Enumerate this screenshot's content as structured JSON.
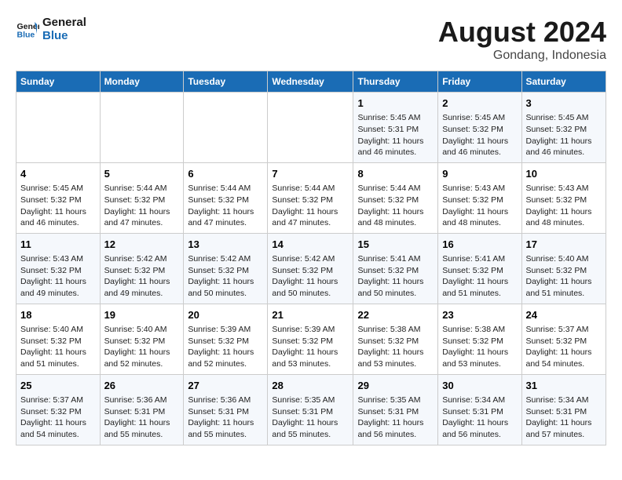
{
  "logo": {
    "line1": "General",
    "line2": "Blue"
  },
  "title": "August 2024",
  "subtitle": "Gondang, Indonesia",
  "days_header": [
    "Sunday",
    "Monday",
    "Tuesday",
    "Wednesday",
    "Thursday",
    "Friday",
    "Saturday"
  ],
  "weeks": [
    [
      {
        "num": "",
        "info": ""
      },
      {
        "num": "",
        "info": ""
      },
      {
        "num": "",
        "info": ""
      },
      {
        "num": "",
        "info": ""
      },
      {
        "num": "1",
        "info": "Sunrise: 5:45 AM\nSunset: 5:31 PM\nDaylight: 11 hours and 46 minutes."
      },
      {
        "num": "2",
        "info": "Sunrise: 5:45 AM\nSunset: 5:32 PM\nDaylight: 11 hours and 46 minutes."
      },
      {
        "num": "3",
        "info": "Sunrise: 5:45 AM\nSunset: 5:32 PM\nDaylight: 11 hours and 46 minutes."
      }
    ],
    [
      {
        "num": "4",
        "info": "Sunrise: 5:45 AM\nSunset: 5:32 PM\nDaylight: 11 hours and 46 minutes."
      },
      {
        "num": "5",
        "info": "Sunrise: 5:44 AM\nSunset: 5:32 PM\nDaylight: 11 hours and 47 minutes."
      },
      {
        "num": "6",
        "info": "Sunrise: 5:44 AM\nSunset: 5:32 PM\nDaylight: 11 hours and 47 minutes."
      },
      {
        "num": "7",
        "info": "Sunrise: 5:44 AM\nSunset: 5:32 PM\nDaylight: 11 hours and 47 minutes."
      },
      {
        "num": "8",
        "info": "Sunrise: 5:44 AM\nSunset: 5:32 PM\nDaylight: 11 hours and 48 minutes."
      },
      {
        "num": "9",
        "info": "Sunrise: 5:43 AM\nSunset: 5:32 PM\nDaylight: 11 hours and 48 minutes."
      },
      {
        "num": "10",
        "info": "Sunrise: 5:43 AM\nSunset: 5:32 PM\nDaylight: 11 hours and 48 minutes."
      }
    ],
    [
      {
        "num": "11",
        "info": "Sunrise: 5:43 AM\nSunset: 5:32 PM\nDaylight: 11 hours and 49 minutes."
      },
      {
        "num": "12",
        "info": "Sunrise: 5:42 AM\nSunset: 5:32 PM\nDaylight: 11 hours and 49 minutes."
      },
      {
        "num": "13",
        "info": "Sunrise: 5:42 AM\nSunset: 5:32 PM\nDaylight: 11 hours and 50 minutes."
      },
      {
        "num": "14",
        "info": "Sunrise: 5:42 AM\nSunset: 5:32 PM\nDaylight: 11 hours and 50 minutes."
      },
      {
        "num": "15",
        "info": "Sunrise: 5:41 AM\nSunset: 5:32 PM\nDaylight: 11 hours and 50 minutes."
      },
      {
        "num": "16",
        "info": "Sunrise: 5:41 AM\nSunset: 5:32 PM\nDaylight: 11 hours and 51 minutes."
      },
      {
        "num": "17",
        "info": "Sunrise: 5:40 AM\nSunset: 5:32 PM\nDaylight: 11 hours and 51 minutes."
      }
    ],
    [
      {
        "num": "18",
        "info": "Sunrise: 5:40 AM\nSunset: 5:32 PM\nDaylight: 11 hours and 51 minutes."
      },
      {
        "num": "19",
        "info": "Sunrise: 5:40 AM\nSunset: 5:32 PM\nDaylight: 11 hours and 52 minutes."
      },
      {
        "num": "20",
        "info": "Sunrise: 5:39 AM\nSunset: 5:32 PM\nDaylight: 11 hours and 52 minutes."
      },
      {
        "num": "21",
        "info": "Sunrise: 5:39 AM\nSunset: 5:32 PM\nDaylight: 11 hours and 53 minutes."
      },
      {
        "num": "22",
        "info": "Sunrise: 5:38 AM\nSunset: 5:32 PM\nDaylight: 11 hours and 53 minutes."
      },
      {
        "num": "23",
        "info": "Sunrise: 5:38 AM\nSunset: 5:32 PM\nDaylight: 11 hours and 53 minutes."
      },
      {
        "num": "24",
        "info": "Sunrise: 5:37 AM\nSunset: 5:32 PM\nDaylight: 11 hours and 54 minutes."
      }
    ],
    [
      {
        "num": "25",
        "info": "Sunrise: 5:37 AM\nSunset: 5:32 PM\nDaylight: 11 hours and 54 minutes."
      },
      {
        "num": "26",
        "info": "Sunrise: 5:36 AM\nSunset: 5:31 PM\nDaylight: 11 hours and 55 minutes."
      },
      {
        "num": "27",
        "info": "Sunrise: 5:36 AM\nSunset: 5:31 PM\nDaylight: 11 hours and 55 minutes."
      },
      {
        "num": "28",
        "info": "Sunrise: 5:35 AM\nSunset: 5:31 PM\nDaylight: 11 hours and 55 minutes."
      },
      {
        "num": "29",
        "info": "Sunrise: 5:35 AM\nSunset: 5:31 PM\nDaylight: 11 hours and 56 minutes."
      },
      {
        "num": "30",
        "info": "Sunrise: 5:34 AM\nSunset: 5:31 PM\nDaylight: 11 hours and 56 minutes."
      },
      {
        "num": "31",
        "info": "Sunrise: 5:34 AM\nSunset: 5:31 PM\nDaylight: 11 hours and 57 minutes."
      }
    ]
  ]
}
